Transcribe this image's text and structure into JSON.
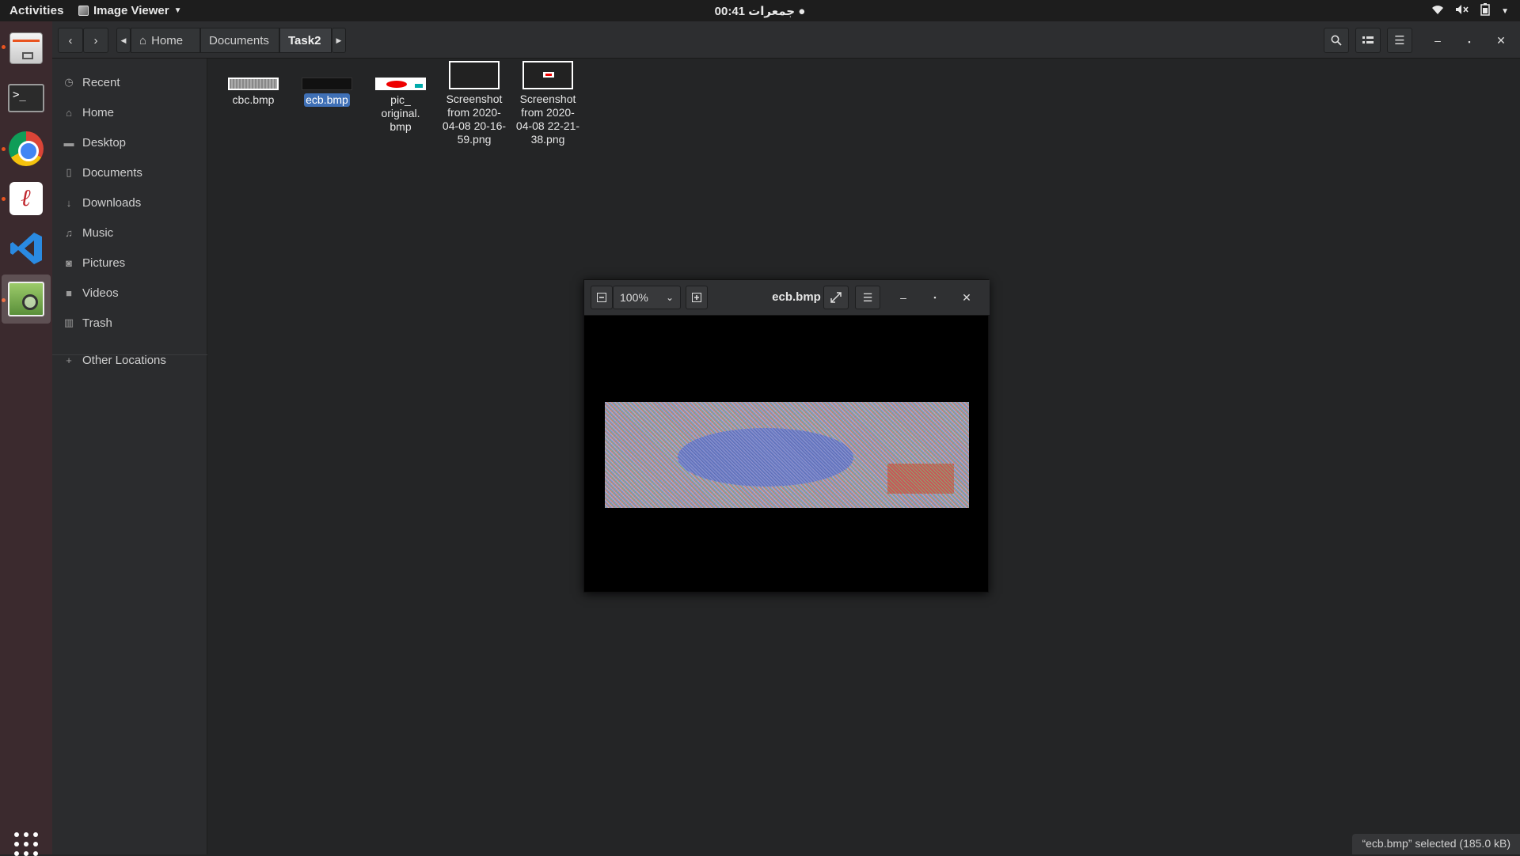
{
  "topbar": {
    "activities": "Activities",
    "app_name": "Image Viewer",
    "clock": "00:41 جمعرات ●"
  },
  "dock": {
    "apps": [
      "Files",
      "Terminal",
      "Google Chrome",
      "Text Editor",
      "Visual Studio Code",
      "Image Viewer"
    ],
    "show_apps_icon": "grid-icon"
  },
  "file_manager": {
    "breadcrumb": [
      "Home",
      "Documents",
      "Task2"
    ],
    "sidebar": [
      {
        "label": "Recent",
        "icon": "clock-icon"
      },
      {
        "label": "Home",
        "icon": "home-icon"
      },
      {
        "label": "Desktop",
        "icon": "folder-icon"
      },
      {
        "label": "Documents",
        "icon": "document-icon"
      },
      {
        "label": "Downloads",
        "icon": "download-icon"
      },
      {
        "label": "Music",
        "icon": "music-icon"
      },
      {
        "label": "Pictures",
        "icon": "camera-icon"
      },
      {
        "label": "Videos",
        "icon": "video-icon"
      },
      {
        "label": "Trash",
        "icon": "trash-icon"
      },
      {
        "label": "Other Locations",
        "icon": "plus-icon"
      }
    ],
    "files": [
      {
        "name": "cbc.bmp"
      },
      {
        "name": "ecb.bmp",
        "selected": true
      },
      {
        "name": "pic_\noriginal.\nbmp"
      },
      {
        "name": "Screenshot\nfrom 2020-\n04-08 20-16-\n59.png"
      },
      {
        "name": "Screenshot\nfrom 2020-\n04-08 22-21-\n38.png"
      }
    ],
    "status": "“ecb.bmp” selected  (185.0 kB)"
  },
  "viewer": {
    "title": "ecb.bmp",
    "zoom": "100%"
  },
  "colors": {
    "accent": "#e95420",
    "selection": "#3f70b6",
    "dock_bg": "#3b2a2e"
  }
}
